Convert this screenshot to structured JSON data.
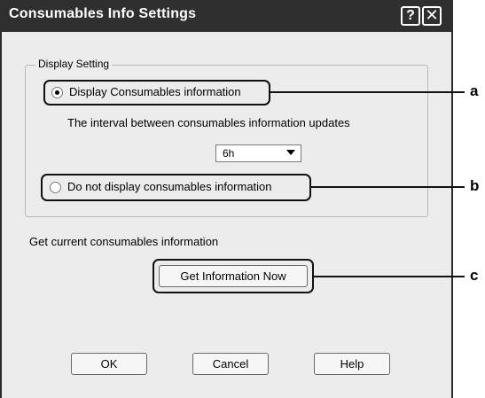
{
  "window": {
    "title": "Consumables Info Settings",
    "help_glyph": "?",
    "close_glyph": "✕"
  },
  "display_setting": {
    "legend": "Display Setting",
    "option_display": "Display Consumables information",
    "interval_label": "The interval between consumables information updates",
    "interval_value": "6h",
    "option_hide": "Do not display consumables information",
    "selected_option": "display"
  },
  "get_info": {
    "label": "Get current consumables information",
    "button": "Get Information Now"
  },
  "footer": {
    "ok": "OK",
    "cancel": "Cancel",
    "help": "Help"
  },
  "callouts": {
    "a": "a",
    "b": "b",
    "c": "c"
  }
}
